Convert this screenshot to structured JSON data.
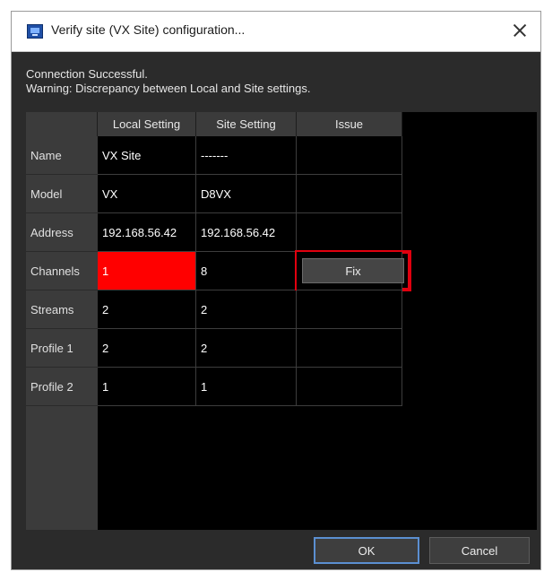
{
  "dialog": {
    "title": "Verify site (VX Site) configuration...",
    "close_symbol": "×"
  },
  "status": {
    "line1": "Connection Successful.",
    "line2": "Warning: Discrepancy between Local and Site settings."
  },
  "table": {
    "columns": [
      "Local Setting",
      "Site Setting",
      "Issue"
    ],
    "rows": [
      {
        "label": "Name",
        "local": "VX Site",
        "site": "-------",
        "issue": ""
      },
      {
        "label": "Model",
        "local": "VX",
        "site": "D8VX",
        "issue": ""
      },
      {
        "label": "Address",
        "local": "192.168.56.42",
        "site": "192.168.56.42",
        "issue": ""
      },
      {
        "label": "Channels",
        "local": "1",
        "site": "8",
        "issue": "Fix"
      },
      {
        "label": "Streams",
        "local": "2",
        "site": "2",
        "issue": ""
      },
      {
        "label": "Profile 1",
        "local": "2",
        "site": "2",
        "issue": ""
      },
      {
        "label": "Profile 2",
        "local": "1",
        "site": "1",
        "issue": ""
      }
    ]
  },
  "buttons": {
    "ok": "OK",
    "cancel": "Cancel"
  },
  "colors": {
    "mismatch_cell": "#ff0000",
    "fix_outline": "#e0000f",
    "dialog_bg": "#2b2b2b",
    "grid_bg": "#000000",
    "header_bg": "#3b3b3b",
    "ok_border": "#5b8fd1"
  },
  "icons": {
    "app": "app-window-icon",
    "close": "close-icon"
  }
}
